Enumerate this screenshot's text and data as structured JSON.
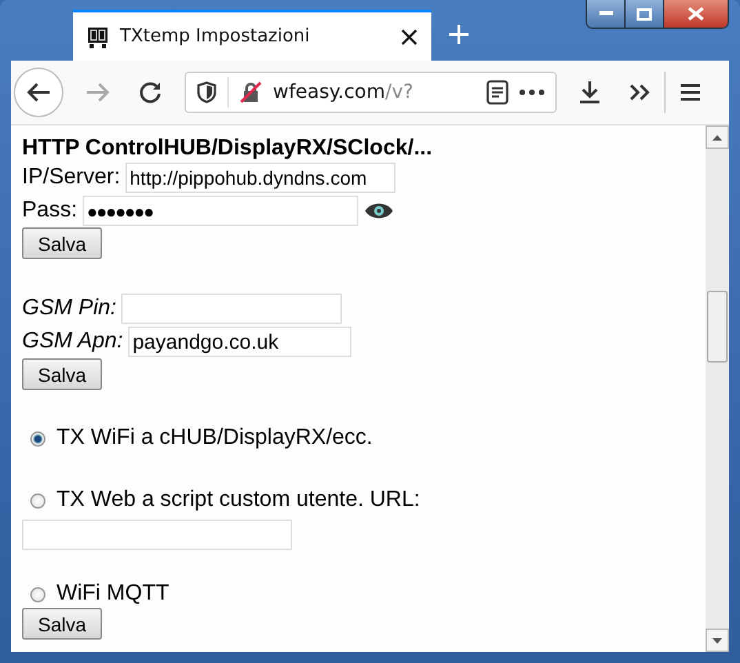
{
  "browser": {
    "tab": {
      "title": "TXtemp Impostazioni",
      "selected": true
    },
    "url": {
      "host": "wfeasy.com",
      "path": "/v?"
    }
  },
  "page": {
    "heading": "HTTP ControlHUB/DisplayRX/SClock/...",
    "server": {
      "label": "IP/Server:",
      "value": "http://pippohub.dyndns.com"
    },
    "password": {
      "label": "Pass:",
      "value": "●●●●●●●"
    },
    "save_buttons": [
      "Salva",
      "Salva",
      "Salva"
    ],
    "gsm_pin": {
      "label": "GSM Pin:"
    },
    "gsm_apn": {
      "label": "GSM Apn:",
      "value": "payandgo.co.uk"
    },
    "modes": [
      {
        "label": "TX WiFi a cHUB/DisplayRX/ecc.",
        "selected": true
      },
      {
        "label": "TX Web a script custom utente. URL:",
        "selected": false
      },
      {
        "label": "WiFi MQTT",
        "selected": false
      }
    ]
  }
}
